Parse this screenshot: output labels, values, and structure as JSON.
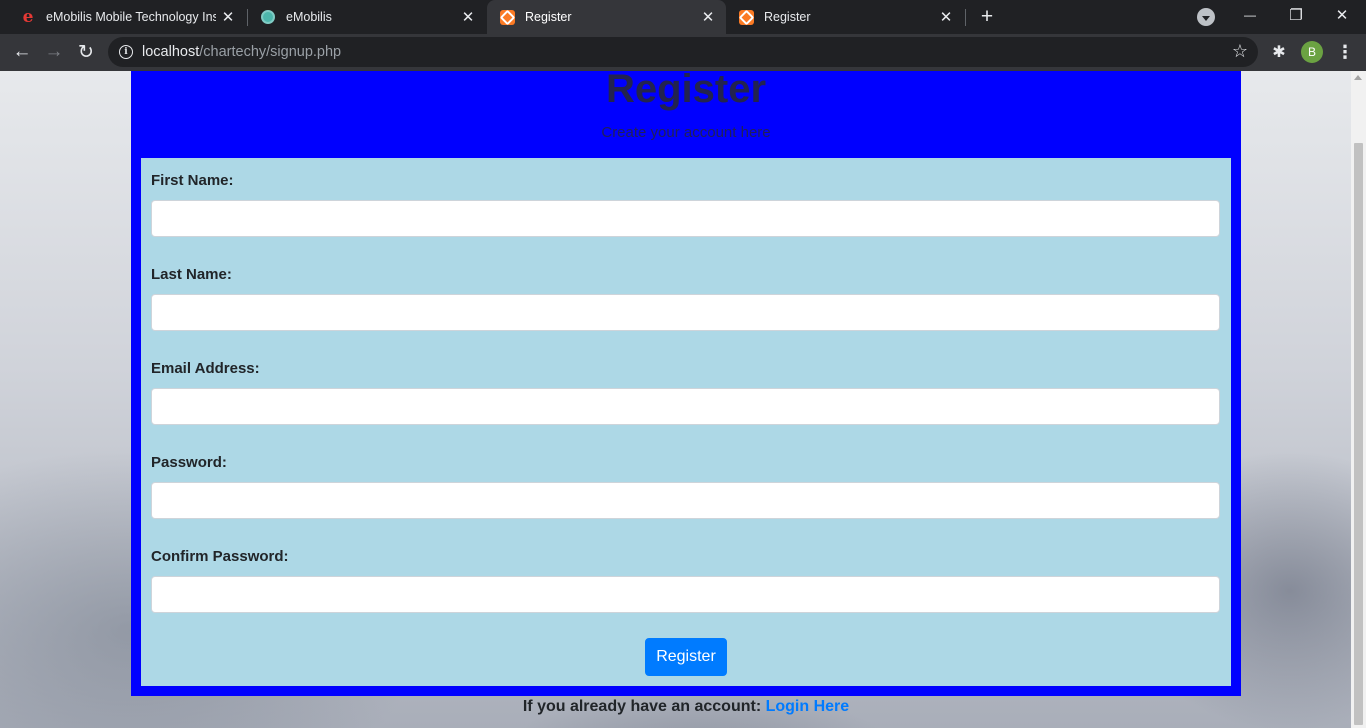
{
  "browser": {
    "tabs": [
      {
        "title": "eMobilis Mobile Technology Institute",
        "favicon": "emobilis-e-icon",
        "active": false
      },
      {
        "title": "eMobilis",
        "favicon": "emobilis-globe-icon",
        "active": false
      },
      {
        "title": "Register",
        "favicon": "xampp-icon",
        "active": true
      },
      {
        "title": "Register",
        "favicon": "xampp-icon",
        "active": false
      }
    ],
    "url_host": "localhost",
    "url_path": "/chartechy/signup.php",
    "profile_initial": "B",
    "glyphs": {
      "close": "✕",
      "new_tab": "+",
      "back": "←",
      "forward": "→",
      "reload": "↻",
      "info": "i",
      "star": "☆",
      "extensions": "✱",
      "menu": "⋮",
      "minimize": "—",
      "restore": "❐"
    }
  },
  "page": {
    "title": "Register",
    "subtitle": "Create your account here",
    "fields": [
      {
        "label": "First Name:",
        "value": "",
        "placeholder": ""
      },
      {
        "label": "Last Name:",
        "value": "",
        "placeholder": ""
      },
      {
        "label": "Email Address:",
        "value": "",
        "placeholder": ""
      },
      {
        "label": "Password:",
        "value": "",
        "placeholder": ""
      },
      {
        "label": "Confirm Password:",
        "value": "",
        "placeholder": ""
      }
    ],
    "submit_label": "Register",
    "footer_text": "If you already have an account:",
    "footer_link": "Login Here"
  },
  "colors": {
    "card_background": "#0000ff",
    "form_background": "#add8e6",
    "button_primary": "#007bff",
    "link": "#007bff"
  }
}
